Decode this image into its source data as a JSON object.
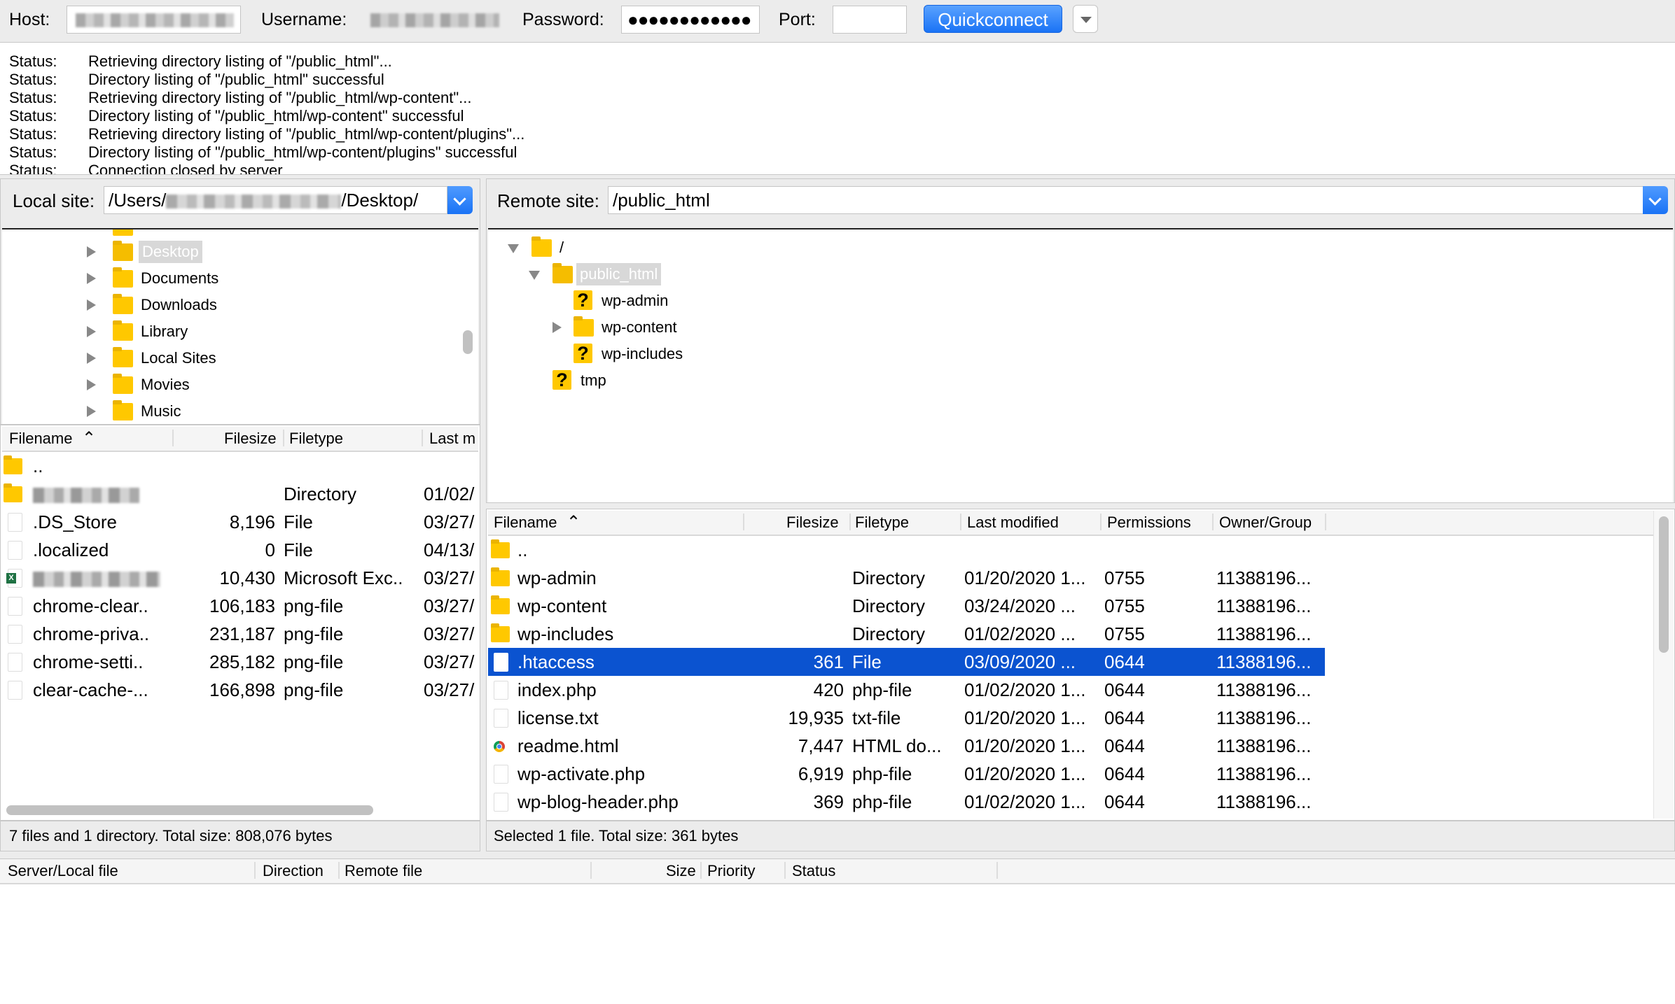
{
  "toolbar": {
    "host_label": "Host:",
    "host_value": "(redacted)",
    "username_label": "Username:",
    "username_value": "(redacted)",
    "password_label": "Password:",
    "password_value": "●●●●●●●●●●●●",
    "port_label": "Port:",
    "port_value": "",
    "quickconnect_label": "Quickconnect"
  },
  "log": [
    {
      "key": "Status:",
      "msg": "Retrieving directory listing of \"/public_html\"..."
    },
    {
      "key": "Status:",
      "msg": "Directory listing of \"/public_html\" successful"
    },
    {
      "key": "Status:",
      "msg": "Retrieving directory listing of \"/public_html/wp-content\"..."
    },
    {
      "key": "Status:",
      "msg": "Directory listing of \"/public_html/wp-content\" successful"
    },
    {
      "key": "Status:",
      "msg": "Retrieving directory listing of \"/public_html/wp-content/plugins\"..."
    },
    {
      "key": "Status:",
      "msg": "Directory listing of \"/public_html/wp-content/plugins\" successful"
    },
    {
      "key": "Status:",
      "msg": "Connection closed by server"
    }
  ],
  "local": {
    "site_label": "Local site:",
    "path_prefix": "/Users/",
    "path_suffix": "/Desktop/",
    "tree": [
      "Desktop",
      "Documents",
      "Downloads",
      "Library",
      "Local Sites",
      "Movies",
      "Music"
    ],
    "columns": [
      "Filename",
      "Filesize",
      "Filetype",
      "Last m"
    ],
    "rows": [
      {
        "name": "..",
        "size": "",
        "type": "",
        "date": "",
        "icon": "folder"
      },
      {
        "name": "(redacted)",
        "size": "",
        "type": "Directory",
        "date": "01/02/",
        "icon": "folder",
        "blur": true
      },
      {
        "name": ".DS_Store",
        "size": "8,196",
        "type": "File",
        "date": "03/27/",
        "icon": "file"
      },
      {
        "name": ".localized",
        "size": "0",
        "type": "File",
        "date": "04/13/",
        "icon": "file"
      },
      {
        "name": "(redacted)",
        "size": "10,430",
        "type": "Microsoft Exc..",
        "date": "03/27/",
        "icon": "excel",
        "blur": true
      },
      {
        "name": "chrome-clear..",
        "size": "106,183",
        "type": "png-file",
        "date": "03/27/",
        "icon": "file"
      },
      {
        "name": "chrome-priva..",
        "size": "231,187",
        "type": "png-file",
        "date": "03/27/",
        "icon": "file"
      },
      {
        "name": "chrome-setti..",
        "size": "285,182",
        "type": "png-file",
        "date": "03/27/",
        "icon": "file"
      },
      {
        "name": "clear-cache-...",
        "size": "166,898",
        "type": "png-file",
        "date": "03/27/",
        "icon": "file"
      }
    ],
    "status": "7 files and 1 directory. Total size: 808,076 bytes"
  },
  "remote": {
    "site_label": "Remote site:",
    "path": "/public_html",
    "tree": [
      {
        "label": "/",
        "level": 0,
        "expander": "down",
        "icon": "folder"
      },
      {
        "label": "public_html",
        "level": 1,
        "expander": "down",
        "icon": "folder-open",
        "selected": true
      },
      {
        "label": "wp-admin",
        "level": 2,
        "expander": "none",
        "icon": "unknown"
      },
      {
        "label": "wp-content",
        "level": 2,
        "expander": "right",
        "icon": "folder"
      },
      {
        "label": "wp-includes",
        "level": 2,
        "expander": "none",
        "icon": "unknown"
      },
      {
        "label": "tmp",
        "level": 1,
        "expander": "none",
        "icon": "unknown"
      }
    ],
    "columns": [
      "Filename",
      "Filesize",
      "Filetype",
      "Last modified",
      "Permissions",
      "Owner/Group"
    ],
    "rows": [
      {
        "name": "..",
        "size": "",
        "type": "",
        "date": "",
        "perm": "",
        "owner": "",
        "icon": "folder"
      },
      {
        "name": "wp-admin",
        "size": "",
        "type": "Directory",
        "date": "01/20/2020 1...",
        "perm": "0755",
        "owner": "11388196...",
        "icon": "folder"
      },
      {
        "name": "wp-content",
        "size": "",
        "type": "Directory",
        "date": "03/24/2020 ...",
        "perm": "0755",
        "owner": "11388196...",
        "icon": "folder"
      },
      {
        "name": "wp-includes",
        "size": "",
        "type": "Directory",
        "date": "01/02/2020 ...",
        "perm": "0755",
        "owner": "11388196...",
        "icon": "folder"
      },
      {
        "name": ".htaccess",
        "size": "361",
        "type": "File",
        "date": "03/09/2020 ...",
        "perm": "0644",
        "owner": "11388196...",
        "icon": "file",
        "selected": true
      },
      {
        "name": "index.php",
        "size": "420",
        "type": "php-file",
        "date": "01/02/2020 1...",
        "perm": "0644",
        "owner": "11388196...",
        "icon": "file"
      },
      {
        "name": "license.txt",
        "size": "19,935",
        "type": "txt-file",
        "date": "01/20/2020 1...",
        "perm": "0644",
        "owner": "11388196...",
        "icon": "file"
      },
      {
        "name": "readme.html",
        "size": "7,447",
        "type": "HTML do...",
        "date": "01/20/2020 1...",
        "perm": "0644",
        "owner": "11388196...",
        "icon": "chrome"
      },
      {
        "name": "wp-activate.php",
        "size": "6,919",
        "type": "php-file",
        "date": "01/20/2020 1...",
        "perm": "0644",
        "owner": "11388196...",
        "icon": "file"
      },
      {
        "name": "wp-blog-header.php",
        "size": "369",
        "type": "php-file",
        "date": "01/02/2020 1...",
        "perm": "0644",
        "owner": "11388196...",
        "icon": "file"
      }
    ],
    "status": "Selected 1 file. Total size: 361 bytes"
  },
  "queue": {
    "columns": [
      "Server/Local file",
      "Direction",
      "Remote file",
      "Size",
      "Priority",
      "Status"
    ]
  }
}
